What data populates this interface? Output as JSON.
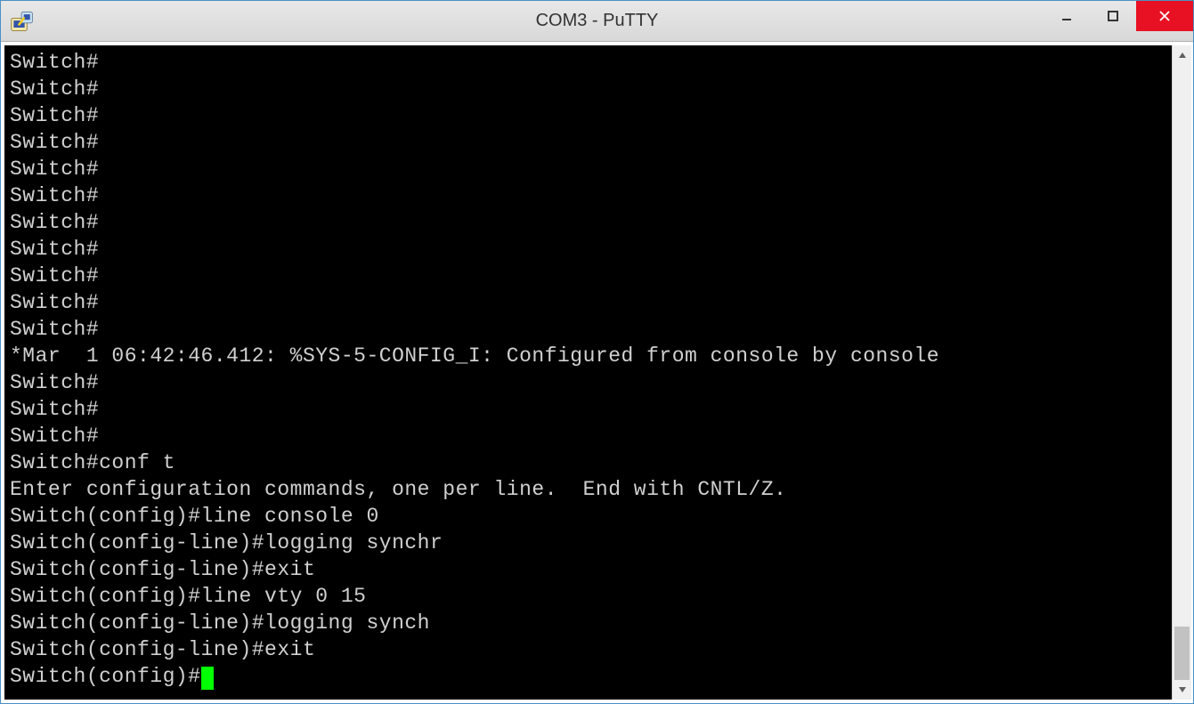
{
  "window": {
    "title": "COM3 - PuTTY"
  },
  "terminal": {
    "lines": [
      "Switch#",
      "Switch#",
      "Switch#",
      "Switch#",
      "Switch#",
      "Switch#",
      "Switch#",
      "Switch#",
      "Switch#",
      "Switch#",
      "Switch#",
      "*Mar  1 06:42:46.412: %SYS-5-CONFIG_I: Configured from console by console",
      "Switch#",
      "Switch#",
      "Switch#",
      "Switch#conf t",
      "Enter configuration commands, one per line.  End with CNTL/Z.",
      "Switch(config)#line console 0",
      "Switch(config-line)#logging synchr",
      "Switch(config-line)#exit",
      "Switch(config)#line vty 0 15",
      "Switch(config-line)#logging synch",
      "Switch(config-line)#exit"
    ],
    "current_prompt": "Switch(config)#"
  },
  "colors": {
    "terminal_bg": "#000000",
    "terminal_fg": "#d0d0d0",
    "cursor": "#00ff00",
    "close_btn": "#e81123"
  }
}
